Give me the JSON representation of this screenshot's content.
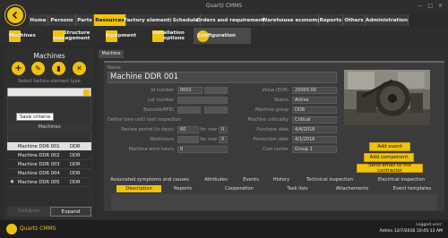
{
  "window": {
    "title": "Quartz CMMS"
  },
  "nav_tabs": [
    "Home",
    "Persons",
    "Parts",
    "Resources",
    "Factory elements",
    "Schedule",
    "Orders and requirements",
    "Warehouse economy",
    "Reports",
    "Others",
    "Administration"
  ],
  "ribbon": {
    "machines": "Machines",
    "structure_1": "Structure",
    "structure_2": "management",
    "equipment": "Equipment",
    "installation_1": "Installation",
    "installation_2": "options",
    "configuration": "Configuration"
  },
  "left_panel": {
    "title": "Machines",
    "select_label": "Select factory element type",
    "save_criteria": "Save criteria",
    "machines_header": "Machines",
    "rows": [
      {
        "name": "Machine DDR 001",
        "code": "DDR"
      },
      {
        "name": "Machine DDR 002",
        "code": "DDR"
      },
      {
        "name": "Machine DDR 003",
        "code": "DDR"
      },
      {
        "name": "Machine DDR 004",
        "code": "DDR"
      },
      {
        "name": "Machine DDR 005",
        "code": "DDR"
      }
    ],
    "collapse": "Collapse",
    "expand": "Expand"
  },
  "main": {
    "tab": "Machine",
    "name_label": "Name",
    "name_value": "Machine DDR 001",
    "id_label": "Id number",
    "id_value": "0001",
    "lot_label": "Lot number",
    "barcode_label": "Barcode/RFID",
    "define_label": "Define time until next inspection",
    "review_label": "Review period (in days)",
    "review_value": "60",
    "for_now_1": "for now",
    "review_now": "0",
    "workhours_label": "Workhours",
    "for_now_2": "for now",
    "workhours_now": "0",
    "work_hours_label": "Machine work hours",
    "work_hours_value": "0",
    "value_label": "Value (EUR)",
    "value_value": "25000,00",
    "status_label": "Status",
    "status_value": "Active",
    "group_label": "Machine group",
    "group_value": "DDR",
    "criticality_label": "Machine criticality",
    "criticality_value": "Critical",
    "purchase_label": "Purchase date",
    "purchase_value": "4/4/2016",
    "production_label": "Production date",
    "production_value": "4/1/2016",
    "cost_label": "Cost center",
    "cost_value": "Group 1",
    "add_event": "Add event",
    "add_component": "Add component",
    "send_email": "Send email to the contractor",
    "tabs_row1": [
      "Associated symptoms and causes",
      "Attributes",
      "Events",
      "History",
      "Technical inspection",
      "Electrical inspection"
    ],
    "tabs_row2": [
      "Description",
      "Reports",
      "Cooperation",
      "Task lists",
      "Attachements",
      "Event templates"
    ]
  },
  "footer": {
    "app": "Quartz CMMS",
    "logged": "Logged user:",
    "user": "Admin 12/7/2016 10:45:13 AM"
  }
}
